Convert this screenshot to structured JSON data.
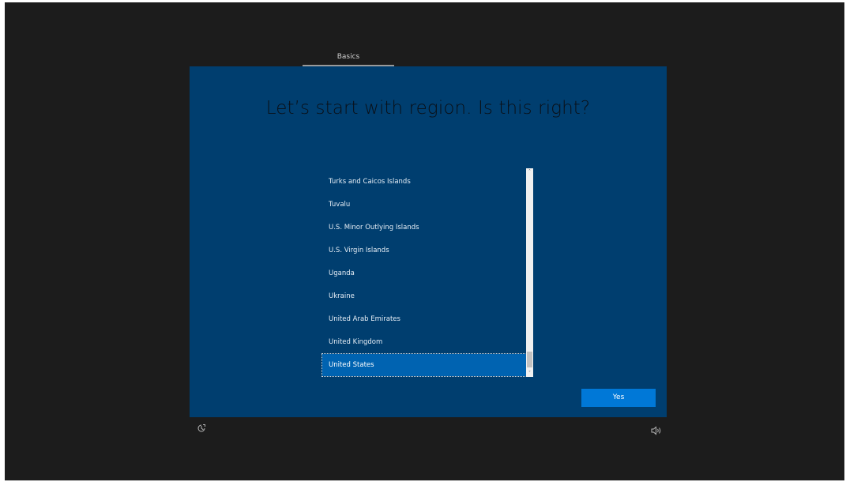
{
  "header": {
    "tab_label": "Basics"
  },
  "page": {
    "title": "Let’s start with region. Is this right?"
  },
  "region_list": {
    "items": [
      "Turks and Caicos Islands",
      "Tuvalu",
      "U.S. Minor Outlying Islands",
      "U.S. Virgin Islands",
      "Uganda",
      "Ukraine",
      "United Arab Emirates",
      "United Kingdom",
      "United States"
    ],
    "selected": "United States"
  },
  "scrollbar": {
    "up_glyph": "˄",
    "down_glyph": "˅"
  },
  "actions": {
    "yes_label": "Yes"
  },
  "icons": {
    "ease_of_access": "ease-of-access-icon",
    "volume": "volume-icon"
  },
  "colors": {
    "panel": "#003e6f",
    "accent": "#0078d7",
    "selected_item": "#0063b1",
    "background": "#1c1c1c"
  }
}
